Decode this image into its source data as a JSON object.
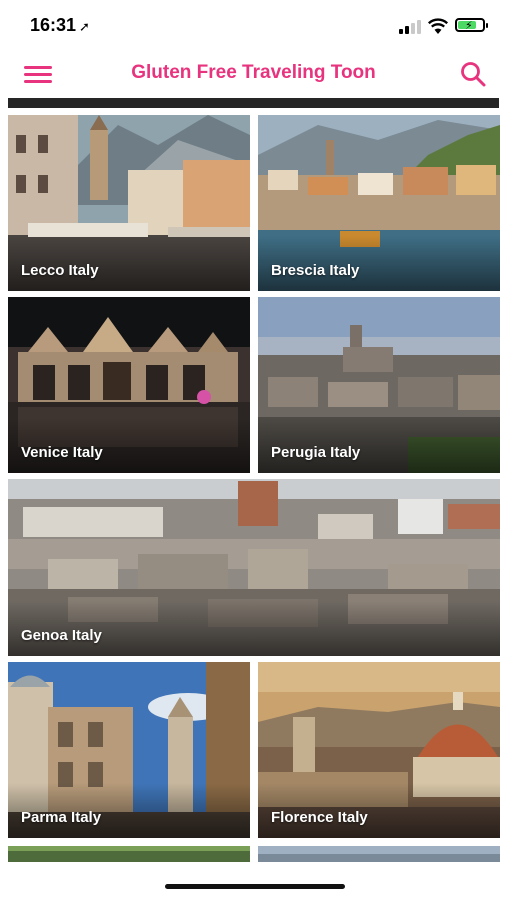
{
  "status_bar": {
    "time": "16:31"
  },
  "header": {
    "title": "Gluten Free Traveling Toon"
  },
  "cities": [
    {
      "label": "Lecco Italy"
    },
    {
      "label": "Brescia Italy"
    },
    {
      "label": "Venice Italy"
    },
    {
      "label": "Perugia Italy"
    },
    {
      "label": "Genoa Italy"
    },
    {
      "label": "Parma Italy"
    },
    {
      "label": "Florence Italy"
    }
  ],
  "colors": {
    "accent": "#e8337e"
  }
}
